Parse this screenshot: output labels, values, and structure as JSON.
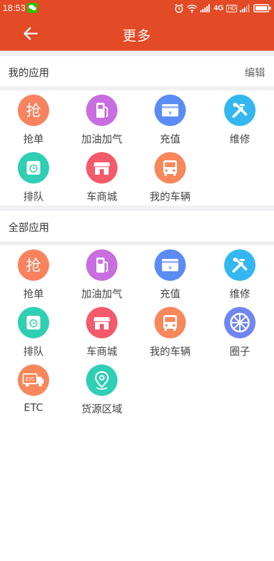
{
  "status_bar": {
    "time": "18:53",
    "network": "4G",
    "hd": "HD"
  },
  "header": {
    "title": "更多"
  },
  "my_apps": {
    "title": "我的应用",
    "edit_label": "编辑",
    "items": [
      {
        "label": "抢单",
        "icon": "grab-order-icon"
      },
      {
        "label": "加油加气",
        "icon": "fuel-pump-icon"
      },
      {
        "label": "充值",
        "icon": "recharge-card-icon"
      },
      {
        "label": "维修",
        "icon": "repair-tools-icon"
      },
      {
        "label": "排队",
        "icon": "queue-clock-icon"
      },
      {
        "label": "车商城",
        "icon": "store-icon"
      },
      {
        "label": "我的车辆",
        "icon": "vehicle-icon"
      }
    ]
  },
  "all_apps": {
    "title": "全部应用",
    "items": [
      {
        "label": "抢单",
        "icon": "grab-order-icon"
      },
      {
        "label": "加油加气",
        "icon": "fuel-pump-icon"
      },
      {
        "label": "充值",
        "icon": "recharge-card-icon"
      },
      {
        "label": "维修",
        "icon": "repair-tools-icon"
      },
      {
        "label": "排队",
        "icon": "queue-clock-icon"
      },
      {
        "label": "车商城",
        "icon": "store-icon"
      },
      {
        "label": "我的车辆",
        "icon": "vehicle-icon"
      },
      {
        "label": "圈子",
        "icon": "circle-wheel-icon"
      },
      {
        "label": "ETC",
        "icon": "etc-truck-icon"
      },
      {
        "label": "货源区域",
        "icon": "location-pin-icon"
      }
    ]
  },
  "colors": {
    "brand": "#e34a26",
    "grab": "#f9825f",
    "fuel": "#c86ee0",
    "recharge": "#5b8cf5",
    "repair": "#33b7f0",
    "queue": "#2fcfb4",
    "store": "#f45a6b",
    "vehicle": "#f8875b",
    "circle": "#6f86f2",
    "etc": "#f8875b",
    "location": "#2fcfb4"
  }
}
